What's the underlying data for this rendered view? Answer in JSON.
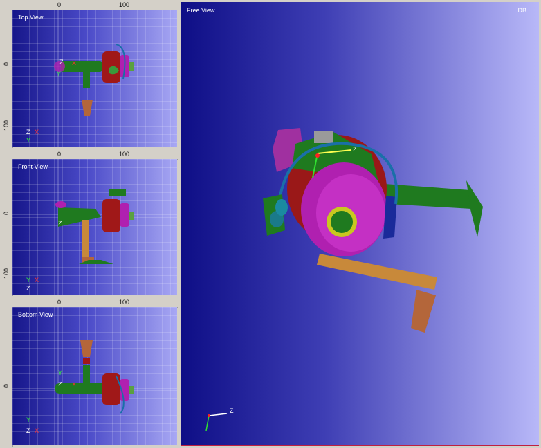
{
  "views": {
    "top": {
      "title": "Top View",
      "ruler_h": [
        "0",
        "100"
      ],
      "ruler_v": [
        "0",
        "100"
      ],
      "triad": [
        "Z",
        "X",
        "Y"
      ]
    },
    "front": {
      "title": "Front View",
      "ruler_h": [
        "0",
        "100"
      ],
      "ruler_v": [
        "0",
        "100"
      ],
      "triad": [
        "Y",
        "X",
        "Z"
      ]
    },
    "bottom": {
      "title": "Bottom View",
      "ruler_h": [
        "0",
        "100"
      ],
      "ruler_v": [
        "0"
      ],
      "triad": [
        "Y",
        "Z",
        "X"
      ]
    },
    "free": {
      "title": "Free View",
      "corner_label": "DB",
      "triad": [
        "Z"
      ]
    }
  },
  "colors": {
    "body_red": "#a01818",
    "spool_magenta": "#b020b0",
    "frame_green": "#1f7a1f",
    "handle_copper": "#b4663a",
    "bail_blue": "#1a6fa8",
    "arm_tan": "#c8893a"
  }
}
